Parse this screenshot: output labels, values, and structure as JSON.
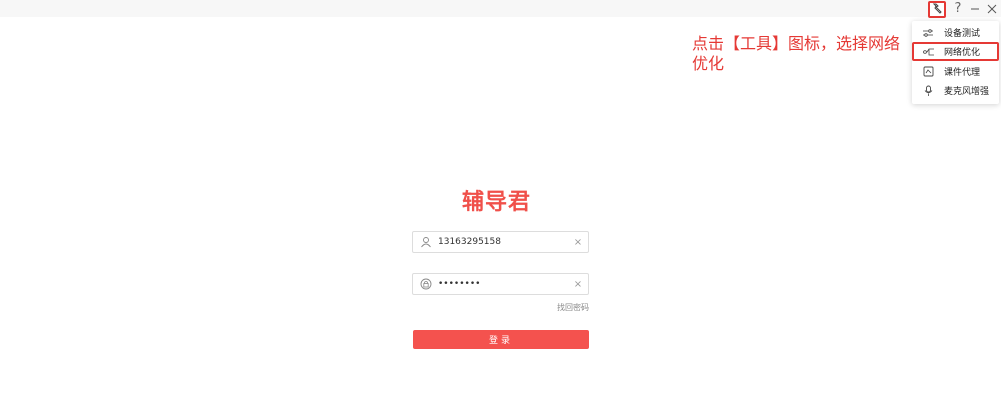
{
  "titlebar": {
    "tool_icon": "wrench-icon",
    "help_label": "?",
    "minimize_icon": "minimize-icon",
    "close_icon": "close-icon"
  },
  "annotation": {
    "text": "点击【工具】图标，选择网络优化"
  },
  "tools_menu": {
    "items": [
      {
        "label": "设备测试",
        "icon": "sliders-icon"
      },
      {
        "label": "网络优化",
        "icon": "network-icon",
        "highlighted": true
      },
      {
        "label": "课件代理",
        "icon": "courseware-icon"
      },
      {
        "label": "麦克风增强",
        "icon": "microphone-icon"
      }
    ]
  },
  "login": {
    "brand": "辅导君",
    "username_value": "13163295158",
    "password_value": "••••••••",
    "clear_label": "×",
    "forgot_label": "找回密码",
    "submit_label": "登录"
  },
  "colors": {
    "accent": "#f4524e",
    "annotation": "#e53935"
  }
}
